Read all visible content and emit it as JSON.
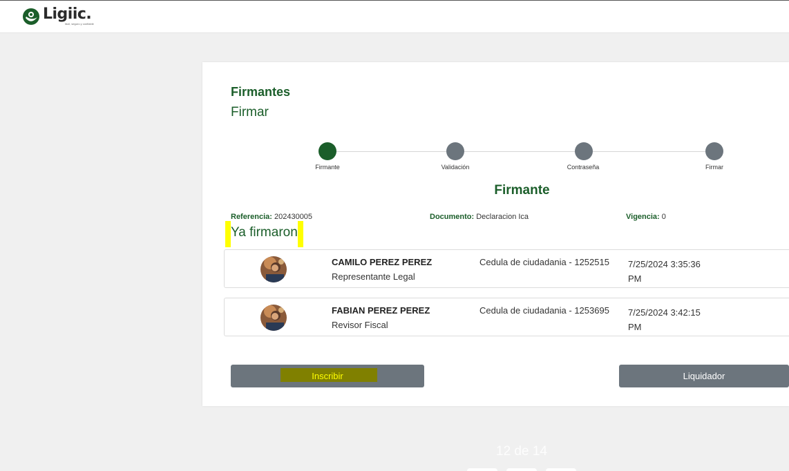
{
  "header": {
    "logo_text": "Ligiic.",
    "logo_tagline": "fácil, seguro y confiable"
  },
  "card": {
    "title": "Firmantes",
    "subtitle": "Firmar"
  },
  "stepper": {
    "steps": [
      {
        "label": "Firmante",
        "active": true
      },
      {
        "label": "Validación",
        "active": false
      },
      {
        "label": "Contraseña",
        "active": false
      },
      {
        "label": "Firmar",
        "active": false
      }
    ]
  },
  "section": {
    "title": "Firmante"
  },
  "info": {
    "referencia_key": "Referencia:",
    "referencia_value": "202430005",
    "documento_key": "Documento:",
    "documento_value": "Declaracion Ica",
    "vigencia_key": "Vigencia:",
    "vigencia_value": "0"
  },
  "signed": {
    "title": "Ya firmaron",
    "signers": [
      {
        "name": "CAMILO PEREZ PEREZ",
        "role": "Representante Legal",
        "document": "Cedula de ciudadania - 1252515",
        "date": "7/25/2024 3:35:36 PM"
      },
      {
        "name": "FABIAN PEREZ PEREZ",
        "role": "Revisor Fiscal",
        "document": "Cedula de ciudadania - 1253695",
        "date": "7/25/2024 3:42:15 PM"
      }
    ]
  },
  "actions": {
    "inscribir_label": "Inscribir",
    "liquidador_label": "Liquidador"
  },
  "pager": {
    "text": "12 de 14"
  },
  "colors": {
    "brand_green": "#1b5e2a",
    "step_inactive": "#6c757d",
    "button_gray": "#6c757d",
    "highlight_yellow": "#ffff00"
  }
}
